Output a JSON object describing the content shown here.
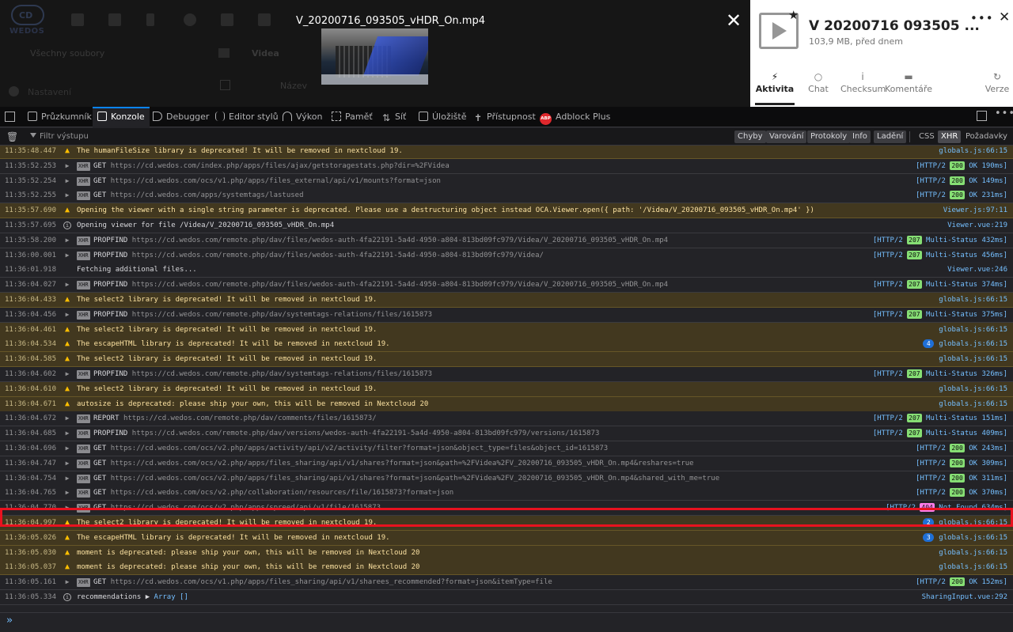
{
  "nextcloud": {
    "logo_text": "CD",
    "logo_brand": "WEDOS",
    "all_files": "Všechny soubory",
    "settings": "Nastavení",
    "breadcrumb": "Videa",
    "name_column": "Název"
  },
  "viewer": {
    "title": "V_20200716_093505_vHDR_On.mp4",
    "close_glyph": "✕"
  },
  "sidebar": {
    "file_name": "V 20200716 093505 ...",
    "file_meta": "103,9 MB, před dnem",
    "more_glyph": "•••",
    "close_glyph": "✕",
    "star_glyph": "★",
    "tabs": [
      {
        "label": "Aktivita",
        "icon": "⚡",
        "active": true
      },
      {
        "label": "Chat",
        "icon": "○"
      },
      {
        "label": "Checksum",
        "icon": "i"
      },
      {
        "label": "Komentáře",
        "icon": "▬"
      },
      {
        "label": "Verze",
        "icon": "↻"
      }
    ]
  },
  "devtools": {
    "tabs": [
      {
        "label": "Průzkumník"
      },
      {
        "label": "Konzole",
        "active": true
      },
      {
        "label": "Debugger"
      },
      {
        "label": "Editor stylů"
      },
      {
        "label": "Výkon"
      },
      {
        "label": "Paměť"
      },
      {
        "label": "Síť"
      },
      {
        "label": "Úložiště"
      },
      {
        "label": "Přístupnost"
      },
      {
        "label": "Adblock Plus"
      }
    ],
    "abp_badge": "ABP",
    "menu_glyph": "•••",
    "filter_placeholder": "Filtr výstupu",
    "filter_buttons": [
      "Chyby",
      "Varování",
      "Protokoly",
      "Info",
      "Ladění"
    ],
    "extra_buttons": [
      "CSS",
      "XHR",
      "Požadavky"
    ],
    "active_extra": "XHR",
    "trash_glyph": "🗑"
  },
  "console": {
    "rows": [
      {
        "type": "warn",
        "ts": "11:35:48.447",
        "msg": "The humanFileSize library is deprecated! It will be removed in nextcloud 19.",
        "src": "globals.js:66:15"
      },
      {
        "type": "xhr",
        "ts": "11:35:52.253",
        "method": "GET",
        "url": "https://cd.wedos.com/index.php/apps/files/ajax/getstoragestats.php?dir=%2FVidea",
        "http": "[HTTP/2",
        "code": "200",
        "status": "OK 190ms]"
      },
      {
        "type": "xhr",
        "ts": "11:35:52.254",
        "method": "GET",
        "url": "https://cd.wedos.com/ocs/v1.php/apps/files_external/api/v1/mounts?format=json",
        "http": "[HTTP/2",
        "code": "200",
        "status": "OK 149ms]"
      },
      {
        "type": "xhr",
        "ts": "11:35:52.255",
        "method": "GET",
        "url": "https://cd.wedos.com/apps/systemtags/lastused",
        "http": "[HTTP/2",
        "code": "200",
        "status": "OK 231ms]"
      },
      {
        "type": "warn",
        "ts": "11:35:57.690",
        "msg": "Opening the viewer with a single string parameter is deprecated. Please use a destructuring object instead OCA.Viewer.open({ path: '/Videa/V_20200716_093505_vHDR_On.mp4' })",
        "src": "Viewer.js:97:11"
      },
      {
        "type": "info",
        "ts": "11:35:57.695",
        "msg": "Opening viewer for file  /Videa/V_20200716_093505_vHDR_On.mp4",
        "src": "Viewer.vue:219"
      },
      {
        "type": "xhr",
        "ts": "11:35:58.200",
        "method": "PROPFIND",
        "url": "https://cd.wedos.com/remote.php/dav/files/wedos-auth-4fa22191-5a4d-4950-a804-813bd09fc979/Videa/V_20200716_093505_vHDR_On.mp4",
        "http": "[HTTP/2",
        "code": "207",
        "status": "Multi-Status 432ms]"
      },
      {
        "type": "xhr",
        "ts": "11:36:00.001",
        "method": "PROPFIND",
        "url": "https://cd.wedos.com/remote.php/dav/files/wedos-auth-4fa22191-5a4d-4950-a804-813bd09fc979/Videa/",
        "http": "[HTTP/2",
        "code": "207",
        "status": "Multi-Status 456ms]"
      },
      {
        "type": "log",
        "ts": "11:36:01.918",
        "msg": "Fetching additional files...",
        "src": "Viewer.vue:246"
      },
      {
        "type": "xhr",
        "ts": "11:36:04.027",
        "method": "PROPFIND",
        "url": "https://cd.wedos.com/remote.php/dav/files/wedos-auth-4fa22191-5a4d-4950-a804-813bd09fc979/Videa/V_20200716_093505_vHDR_On.mp4",
        "http": "[HTTP/2",
        "code": "207",
        "status": "Multi-Status 374ms]"
      },
      {
        "type": "warn",
        "ts": "11:36:04.433",
        "msg": "The select2 library is deprecated! It will be removed in nextcloud 19.",
        "src": "globals.js:66:15"
      },
      {
        "type": "xhr",
        "ts": "11:36:04.456",
        "method": "PROPFIND",
        "url": "https://cd.wedos.com/remote.php/dav/systemtags-relations/files/1615873",
        "http": "[HTTP/2",
        "code": "207",
        "status": "Multi-Status 375ms]"
      },
      {
        "type": "warn",
        "ts": "11:36:04.461",
        "msg": "The select2 library is deprecated! It will be removed in nextcloud 19.",
        "src": "globals.js:66:15"
      },
      {
        "type": "warn",
        "ts": "11:36:04.534",
        "msg": "The escapeHTML library is deprecated! It will be removed in nextcloud 19.",
        "src": "globals.js:66:15",
        "count": "4"
      },
      {
        "type": "warn",
        "ts": "11:36:04.585",
        "msg": "The select2 library is deprecated! It will be removed in nextcloud 19.",
        "src": "globals.js:66:15"
      },
      {
        "type": "xhr",
        "ts": "11:36:04.602",
        "method": "PROPFIND",
        "url": "https://cd.wedos.com/remote.php/dav/systemtags-relations/files/1615873",
        "http": "[HTTP/2",
        "code": "207",
        "status": "Multi-Status 326ms]"
      },
      {
        "type": "warn",
        "ts": "11:36:04.610",
        "msg": "The select2 library is deprecated! It will be removed in nextcloud 19.",
        "src": "globals.js:66:15"
      },
      {
        "type": "warn",
        "ts": "11:36:04.671",
        "msg": "autosize is deprecated: please ship your own, this will be removed in Nextcloud 20",
        "src": "globals.js:66:15"
      },
      {
        "type": "xhr",
        "ts": "11:36:04.672",
        "method": "REPORT",
        "url": "https://cd.wedos.com/remote.php/dav/comments/files/1615873/",
        "http": "[HTTP/2",
        "code": "207",
        "status": "Multi-Status 151ms]"
      },
      {
        "type": "xhr",
        "ts": "11:36:04.685",
        "method": "PROPFIND",
        "url": "https://cd.wedos.com/remote.php/dav/versions/wedos-auth-4fa22191-5a4d-4950-a804-813bd09fc979/versions/1615873",
        "http": "[HTTP/2",
        "code": "207",
        "status": "Multi-Status 409ms]"
      },
      {
        "type": "xhr",
        "ts": "11:36:04.696",
        "method": "GET",
        "url": "https://cd.wedos.com/ocs/v2.php/apps/activity/api/v2/activity/filter?format=json&object_type=files&object_id=1615873",
        "http": "[HTTP/2",
        "code": "200",
        "status": "OK 243ms]"
      },
      {
        "type": "xhr",
        "ts": "11:36:04.747",
        "method": "GET",
        "url": "https://cd.wedos.com/ocs/v2.php/apps/files_sharing/api/v1/shares?format=json&path=%2FVidea%2FV_20200716_093505_vHDR_On.mp4&reshares=true",
        "http": "[HTTP/2",
        "code": "200",
        "status": "OK 309ms]"
      },
      {
        "type": "xhr",
        "ts": "11:36:04.754",
        "method": "GET",
        "url": "https://cd.wedos.com/ocs/v2.php/apps/files_sharing/api/v1/shares?format=json&path=%2FVidea%2FV_20200716_093505_vHDR_On.mp4&shared_with_me=true",
        "http": "[HTTP/2",
        "code": "200",
        "status": "OK 311ms]"
      },
      {
        "type": "xhr",
        "ts": "11:36:04.765",
        "method": "GET",
        "url": "https://cd.wedos.com/ocs/v2.php/collaboration/resources/file/1615873?format=json",
        "http": "[HTTP/2",
        "code": "200",
        "status": "OK 370ms]"
      },
      {
        "type": "xhr",
        "ts": "11:36:04.770",
        "method": "GET",
        "url": "https://cd.wedos.com/ocs/v2.php/apps/spreed/api/v1/file/1615873",
        "http": "[HTTP/2",
        "code": "404",
        "status": "Not Found 634ms]",
        "error": true
      },
      {
        "type": "warn",
        "ts": "11:36:04.997",
        "msg": "The select2 library is deprecated! It will be removed in nextcloud 19.",
        "src": "globals.js:66:15",
        "count": "2"
      },
      {
        "type": "warn",
        "ts": "11:36:05.026",
        "msg": "The escapeHTML library is deprecated! It will be removed in nextcloud 19.",
        "src": "globals.js:66:15",
        "count": "3"
      },
      {
        "type": "warn",
        "ts": "11:36:05.030",
        "msg": "moment is deprecated: please ship your own, this will be removed in Nextcloud 20",
        "src": "globals.js:66:15"
      },
      {
        "type": "warn",
        "ts": "11:36:05.037",
        "msg": "moment is deprecated: please ship your own, this will be removed in Nextcloud 20",
        "src": "globals.js:66:15"
      },
      {
        "type": "xhr",
        "ts": "11:36:05.161",
        "method": "GET",
        "url": "https://cd.wedos.com/ocs/v1.php/apps/files_sharing/api/v1/sharees_recommended?format=json&itemType=file",
        "http": "[HTTP/2",
        "code": "200",
        "status": "OK 152ms]"
      },
      {
        "type": "info",
        "ts": "11:36:05.334",
        "msg": "recommendations",
        "arr": "Array []",
        "src": "SharingInput.vue:292"
      }
    ],
    "prompt_glyph": "»"
  },
  "colors": {
    "warn_bg": "#42381f",
    "highlight": "#e8121f",
    "ok_badge": "#86de74",
    "err_badge": "#ff7de9"
  }
}
